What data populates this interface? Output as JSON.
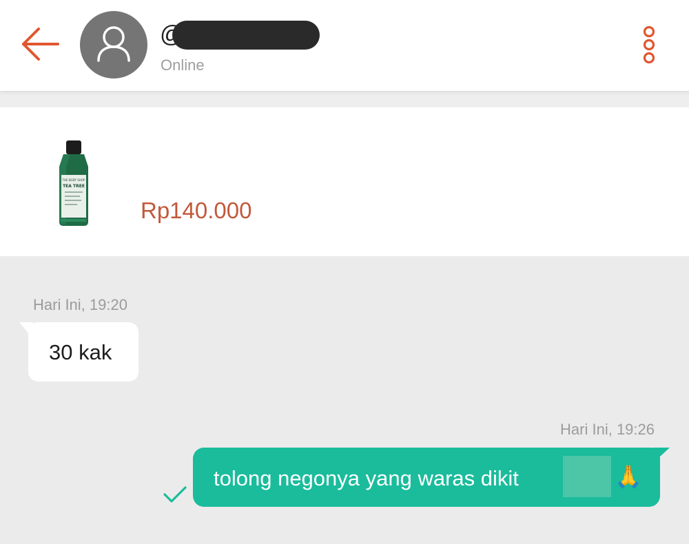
{
  "header": {
    "username": "@",
    "status": "Online"
  },
  "product": {
    "price": "Rp140.000",
    "label_brand": "THE BODY SHOP",
    "label_name": "TEA TREE"
  },
  "messages": [
    {
      "timestamp": "Hari Ini, 19:20",
      "text": "30 kak",
      "direction": "incoming"
    },
    {
      "timestamp": "Hari Ini, 19:26",
      "text": "tolong negonya yang waras dikit",
      "emoji": "🙏",
      "direction": "outgoing"
    }
  ],
  "colors": {
    "accent": "#e0562f",
    "price": "#c1593a",
    "outgoing_bubble": "#1abc9c",
    "read_check": "#1abc9c"
  }
}
